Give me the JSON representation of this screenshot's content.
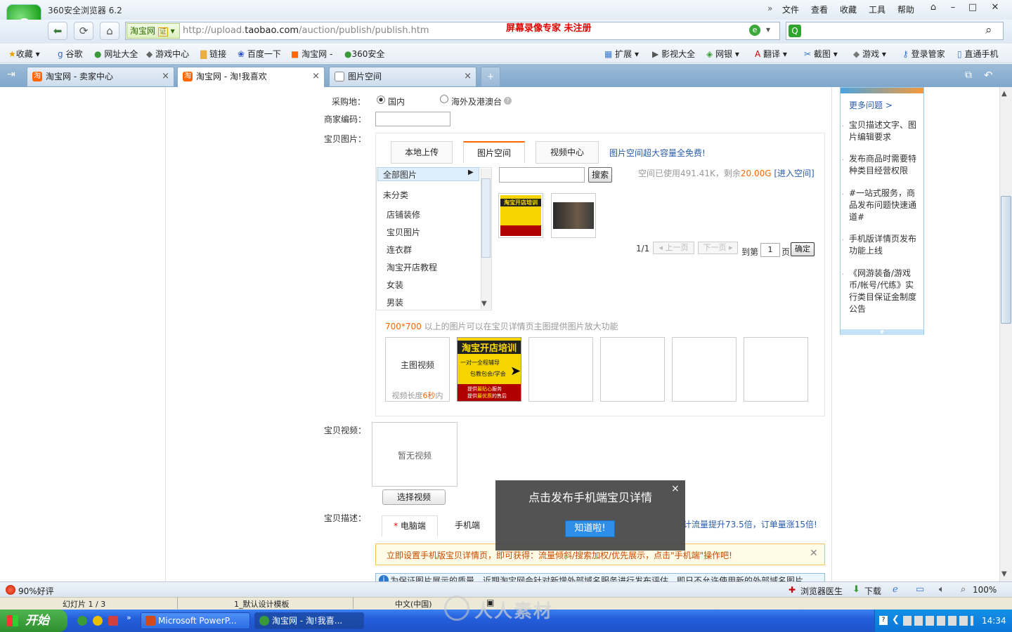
{
  "browser": {
    "title": "360安全浏览器 6.2",
    "menu": [
      "文件",
      "查看",
      "收藏",
      "工具",
      "帮助"
    ],
    "site_badge": "淘宝网",
    "cert_badge": "证",
    "url_prefix": "http://upload.",
    "url_host": "taobao.com",
    "url_path": "/auction/publish/publish.htm",
    "recorder_watermark": "屏幕录像专家  未注册"
  },
  "favorites": {
    "left": [
      "收藏",
      "谷歌",
      "网址大全",
      "游戏中心",
      "链接",
      "百度一下",
      "淘宝网",
      "360安全"
    ],
    "right": [
      "扩展",
      "影视大全",
      "网银",
      "翻译",
      "截图",
      "游戏",
      "登录管家",
      "直通手机"
    ]
  },
  "tabs": [
    {
      "label": "淘宝网 - 卖家中心"
    },
    {
      "label": "淘宝网 - 淘!我喜欢"
    },
    {
      "label": "图片空间"
    }
  ],
  "form": {
    "purchase_label": "采购地：",
    "purchase_domestic": "国内",
    "purchase_overseas": "海外及港澳台",
    "merchant_code_label": "商家编码：",
    "item_image_label": "宝贝图片：",
    "image_tabs": [
      "本地上传",
      "图片空间",
      "视频中心"
    ],
    "image_space_promo": "图片空间超大容量全免费!",
    "categories_all": "全部图片",
    "categories": [
      "未分类",
      "店铺装修",
      "宝贝图片",
      "连衣群",
      "淘宝开店教程",
      "女装",
      "男装"
    ],
    "search_button": "搜索",
    "space_used_text": "空间已使用491.41K，剩余",
    "space_left": "20.00G",
    "enter_space": "[进入空间]",
    "pagination": {
      "current": "1/1",
      "prev": "上一页",
      "next": "下一页",
      "goto_prefix": "到第",
      "goto_value": "1",
      "goto_suffix": "页",
      "confirm": "确定"
    },
    "zoom_hint_size": "700*700",
    "zoom_hint_text": " 以上的图片可以在宝贝详情页主图提供图片放大功能",
    "main_video_slot_title": "主图视频",
    "main_video_slot_prefix": "视频长度",
    "main_video_slot_seconds": "6秒",
    "main_video_slot_suffix": "内",
    "item_video_label": "宝贝视频：",
    "no_video": "暂无视频",
    "select_video_button": "选择视频",
    "desc_label": "宝贝描述：",
    "desc_tab_pc": "电脑端",
    "desc_tab_mobile": "手机端",
    "desc_promo": "计流量提升73.5倍，订单量涨15倍!",
    "mobile_notice": "立即设置手机版宝贝详情页，即可获得：流量倾斜/搜索加权/优先展示，点击\"手机端\"操作吧!",
    "image_notice": "为保证图片展示的质量，近期淘宝网会针对新增外部域名服务进行发布评估，即日不允许使用新的外部域名图片"
  },
  "thumbnail_text": {
    "banner": "淘宝开店培训",
    "line1": "一对一全程辅导",
    "line2": "包教包会/学会",
    "bottom1": "提供",
    "bottom1_hl": "最贴心",
    "bottom1_end": "服务",
    "bottom2": "提供",
    "bottom2_hl": "最优质",
    "bottom2_end": "的售后"
  },
  "sidebar": {
    "more": "更多问题 >",
    "items": [
      "宝贝描述文字、图片编辑要求",
      "发布商品时需要特种类目经营权限",
      "#一站式服务，商品发布问题快速通道#",
      "手机版详情页发布功能上线",
      "《网游装备/游戏币/帐号/代练》实行类目保证金制度公告"
    ]
  },
  "popup": {
    "title": "点击发布手机端宝贝详情",
    "button": "知道啦!",
    "close": "×"
  },
  "statusbar": {
    "rating": "90%好评",
    "doctor": "浏览器医生",
    "download": "下载",
    "zoom": "100%"
  },
  "ppt": {
    "slide": "幻灯片 1 / 3",
    "template": "1_默认设计模板",
    "lang": "中文(中国)"
  },
  "taskbar": {
    "start": "开始",
    "items": [
      "Microsoft PowerP...",
      "淘宝网 - 淘!我喜..."
    ],
    "watermark": "人人素材",
    "time": "14:34"
  }
}
